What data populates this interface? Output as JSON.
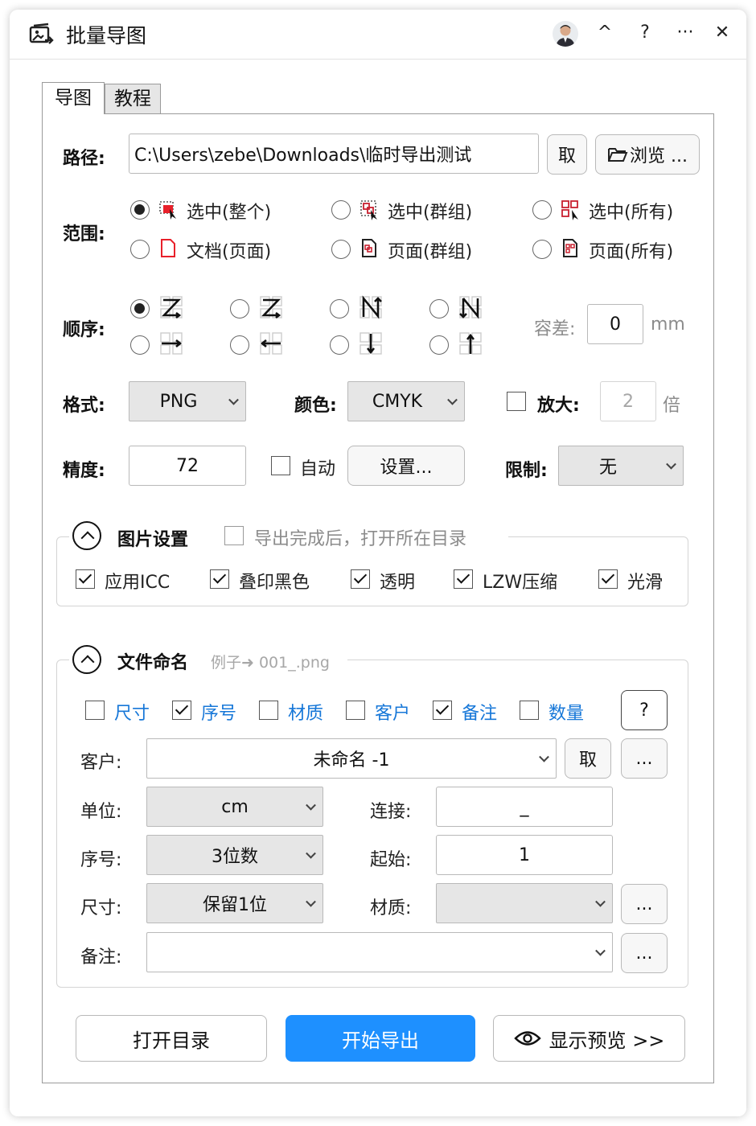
{
  "window": {
    "title": "批量导图",
    "controls": {
      "collapse": "^",
      "help": "?",
      "more": "···",
      "close": "✕"
    }
  },
  "tabs": [
    "导图",
    "教程"
  ],
  "path": {
    "label": "路径:",
    "value": "C:\\Users\\zebe\\Downloads\\临时导出测试",
    "pick_button": "取",
    "browse_button": "浏览 ..."
  },
  "range": {
    "label": "范围:",
    "options": [
      {
        "label": "选中(整个)",
        "color": "#148a74",
        "checked": true
      },
      {
        "label": "选中(群组)",
        "color": "#148a74",
        "checked": false
      },
      {
        "label": "选中(所有)",
        "color": "#9a1a1a",
        "checked": false
      },
      {
        "label": "文档(页面)",
        "color": "#ef5c86",
        "checked": false
      },
      {
        "label": "页面(群组)",
        "color": "#c8202f",
        "checked": false
      },
      {
        "label": "页面(所有)",
        "color": "#c8202f",
        "checked": false
      }
    ]
  },
  "order": {
    "label": "顺序:",
    "selected_index": 0,
    "icons": [
      "z-forward-icon",
      "z-reverse-icon",
      "n-down-icon",
      "n-reverse-icon",
      "arrow-right-icon",
      "arrow-left-icon",
      "arrow-down-icon",
      "arrow-up-icon"
    ],
    "tolerance_label": "容差:",
    "tolerance_value": "0",
    "tolerance_unit": "mm"
  },
  "format": {
    "label": "格式:",
    "value": "PNG",
    "color_label": "颜色:",
    "color_value": "CMYK",
    "zoom_label": "放大:",
    "zoom_checked": false,
    "zoom_value": "2",
    "zoom_unit": "倍"
  },
  "precision": {
    "label": "精度:",
    "value": "72",
    "auto_label": "自动",
    "auto_checked": false,
    "settings_button": "设置...",
    "limit_label": "限制:",
    "limit_value": "无"
  },
  "image_settings": {
    "title": "图片设置",
    "open_after_label": "导出完成后，打开所在目录",
    "open_after_checked": false,
    "options": [
      {
        "label": "应用ICC",
        "checked": true
      },
      {
        "label": "叠印黑色",
        "checked": true
      },
      {
        "label": "透明",
        "checked": true
      },
      {
        "label": "LZW压缩",
        "checked": true
      },
      {
        "label": "光滑",
        "checked": true
      }
    ]
  },
  "file_naming": {
    "title": "文件命名",
    "example": "例子➜ 001_.png",
    "parts": [
      {
        "label": "尺寸",
        "checked": false
      },
      {
        "label": "序号",
        "checked": true
      },
      {
        "label": "材质",
        "checked": false
      },
      {
        "label": "客户",
        "checked": false
      },
      {
        "label": "备注",
        "checked": true
      },
      {
        "label": "数量",
        "checked": false
      }
    ],
    "help_button": "?",
    "customer_label": "客户:",
    "customer_value": "未命名 -1",
    "customer_pick": "取",
    "customer_more": "...",
    "unit_label": "单位:",
    "unit_value": "cm",
    "connector_label": "连接:",
    "connector_value": "_",
    "seq_label": "序号:",
    "seq_value": "3位数",
    "start_label": "起始:",
    "start_value": "1",
    "size_label": "尺寸:",
    "size_value": "保留1位",
    "material_label": "材质:",
    "material_value": "",
    "material_more": "...",
    "note_label": "备注:",
    "note_value": "",
    "note_more": "..."
  },
  "actions": {
    "open_dir": "打开目录",
    "start_export": "开始导出",
    "show_preview": "显示预览 >>"
  },
  "colors": {
    "primary": "#1e90ff",
    "label_blue": "#1677d8"
  }
}
